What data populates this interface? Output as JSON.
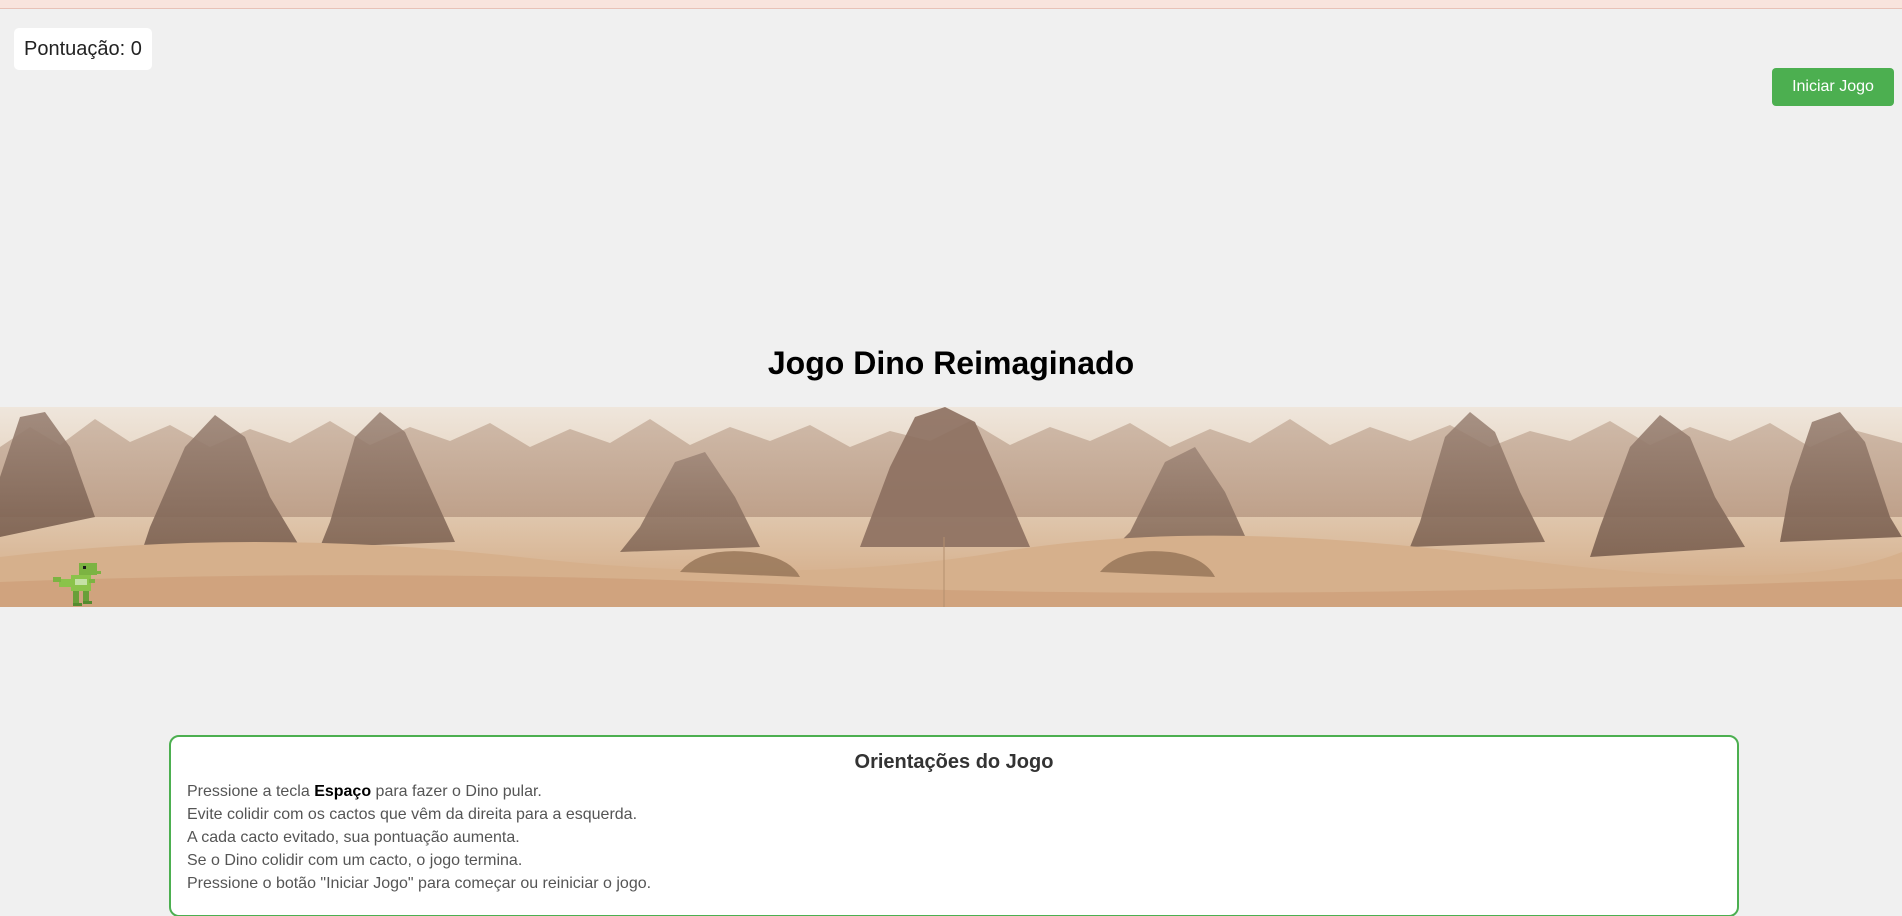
{
  "score": {
    "label": "Pontuação: 0"
  },
  "controls": {
    "start_button": "Iniciar Jogo"
  },
  "title": "Jogo Dino Reimaginado",
  "game": {
    "background": "desert-canyon-backdrop",
    "player": "dino-sprite"
  },
  "instructions": {
    "heading": "Orientações do Jogo",
    "line1_prefix": "Pressione a tecla ",
    "line1_key": "Espaço",
    "line1_suffix": " para fazer o Dino pular.",
    "line2": "Evite colidir com os cactos que vêm da direita para a esquerda.",
    "line3": "A cada cacto evitado, sua pontuação aumenta.",
    "line4": "Se o Dino colidir com um cacto, o jogo termina.",
    "line5": "Pressione o botão \"Iniciar Jogo\" para começar ou reiniciar o jogo."
  },
  "colors": {
    "accent": "#4caf50",
    "page_background": "#f0f0f0",
    "sand": "#d9b48f"
  }
}
